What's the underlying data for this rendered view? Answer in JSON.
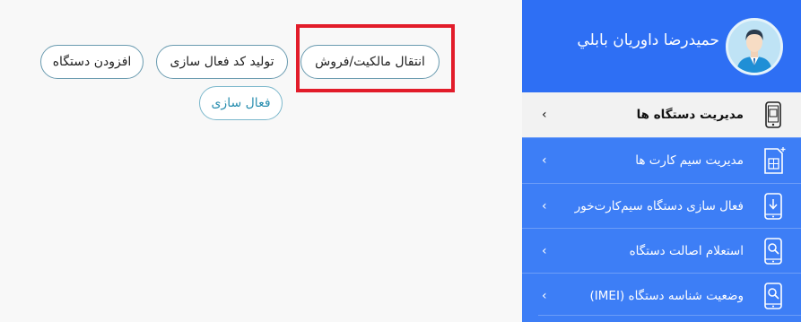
{
  "actions": {
    "add_device": "افزودن دستگاه",
    "generate_activation_code": "تولید کد فعال سازی",
    "transfer_ownership": "انتقال مالکیت/فروش",
    "activate": "فعال سازی"
  },
  "profile": {
    "name": "حمیدرضا داوریان بابلي"
  },
  "sidebar": {
    "items": [
      {
        "label": "مديريت دستگاه ها",
        "icon": "phone-icon",
        "active": true
      },
      {
        "label": "مدیریت سیم کارت ها",
        "icon": "sim-card-icon",
        "active": false
      },
      {
        "label": "فعال سازی دستگاه سیم‌کارت‌خور",
        "icon": "phone-download-icon",
        "active": false
      },
      {
        "label": "استعلام اصالت دستگاه",
        "icon": "phone-search-icon",
        "active": false
      },
      {
        "label": "وضعیت شناسه دستگاه (IMEI)",
        "icon": "phone-search-icon",
        "active": false
      }
    ]
  },
  "colors": {
    "sidebar_bg": "#3d7ef6",
    "profile_bg": "#2e6ff4",
    "highlight": "#e21c2a",
    "active_item_bg": "#f2f2f2"
  }
}
